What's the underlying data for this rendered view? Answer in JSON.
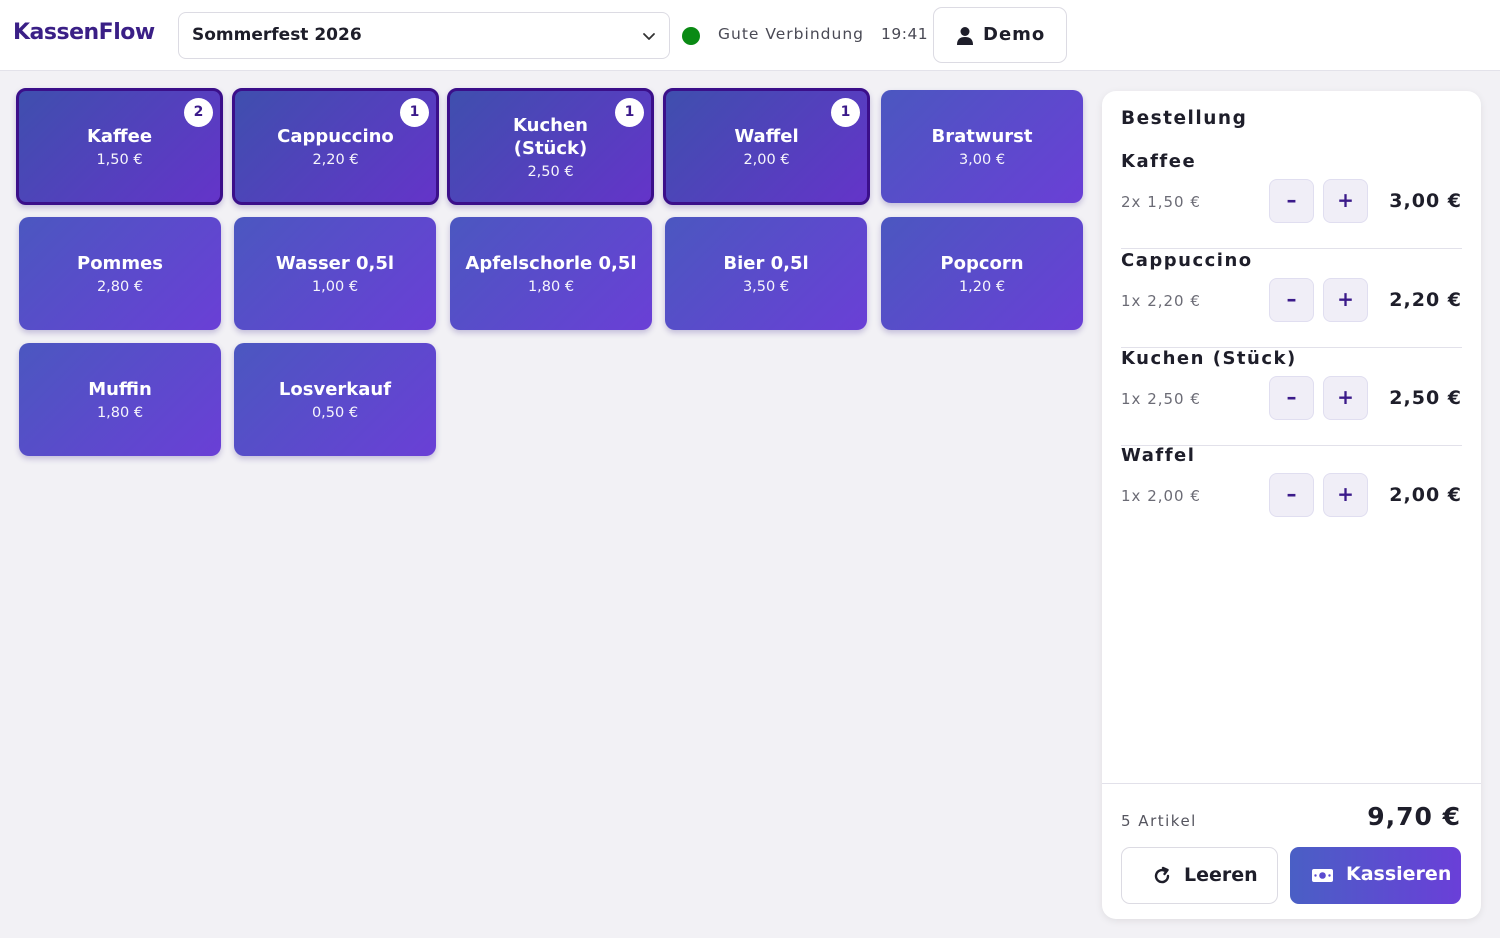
{
  "app": {
    "logo": "KassenFlow"
  },
  "header": {
    "event": "Sommerfest 2026",
    "status": "Gute Verbindung",
    "time": "19:41",
    "user": "Demo",
    "status_color": "#0a8a14"
  },
  "products": [
    {
      "name": "Kaffee",
      "price": "1,50 €",
      "badge": "2"
    },
    {
      "name": "Cappuccino",
      "price": "2,20 €",
      "badge": "1"
    },
    {
      "name": "Kuchen (Stück)",
      "price": "2,50 €",
      "badge": "1"
    },
    {
      "name": "Waffel",
      "price": "2,00 €",
      "badge": "1"
    },
    {
      "name": "Bratwurst",
      "price": "3,00 €"
    },
    {
      "name": "Pommes",
      "price": "2,80 €"
    },
    {
      "name": "Wasser 0,5l",
      "price": "1,00 €"
    },
    {
      "name": "Apfelschorle 0,5l",
      "price": "1,80 €"
    },
    {
      "name": "Bier 0,5l",
      "price": "3,50 €"
    },
    {
      "name": "Popcorn",
      "price": "1,20 €"
    },
    {
      "name": "Muffin",
      "price": "1,80 €"
    },
    {
      "name": "Losverkauf",
      "price": "0,50 €"
    }
  ],
  "order": {
    "title": "Bestellung",
    "items": [
      {
        "name": "Kaffee",
        "qty": "2x 1,50 €",
        "total": "3,00 €"
      },
      {
        "name": "Cappuccino",
        "qty": "1x 2,20 €",
        "total": "2,20 €"
      },
      {
        "name": "Kuchen (Stück)",
        "qty": "1x 2,50 €",
        "total": "2,50 €"
      },
      {
        "name": "Waffel",
        "qty": "1x 2,00 €",
        "total": "2,00 €"
      }
    ],
    "minus_label": "–",
    "plus_label": "+",
    "count": "5 Artikel",
    "sum": "9,70 €",
    "clear_label": "Leeren",
    "pay_label": "Kassieren"
  },
  "colors": {
    "brand": "#3a1f86",
    "tile_start": "#4b57c0",
    "tile_end": "#6a3fd6"
  }
}
